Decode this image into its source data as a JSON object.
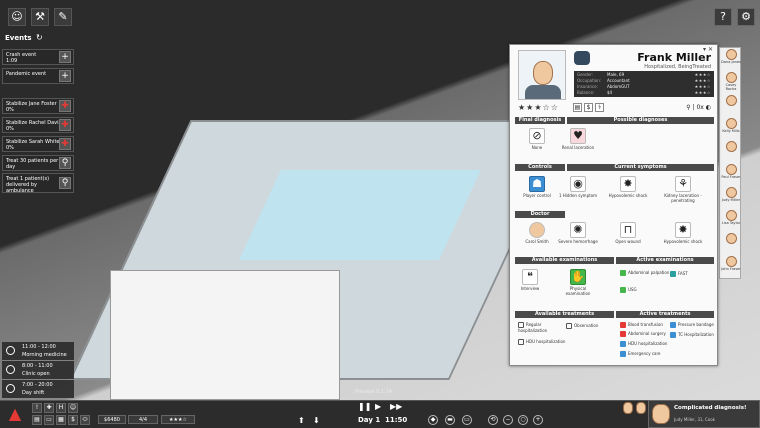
{
  "toolbar": {
    "icons": [
      "staff-icon",
      "hammer-icon",
      "syringe-icon"
    ]
  },
  "events": {
    "title": "Events",
    "items": [
      {
        "label": "Crash event",
        "sub": "1:09",
        "action": "+"
      },
      {
        "label": "Pandemic event",
        "sub": "",
        "action": "+"
      }
    ],
    "tasks": [
      {
        "label": "Stabilize Jane Foster",
        "sub": "0%"
      },
      {
        "label": "Stabilize Rachel Davis",
        "sub": "0%"
      },
      {
        "label": "Stabilize Sarah White",
        "sub": "0%"
      },
      {
        "label": "Treat 30 patients per",
        "sub": "day"
      },
      {
        "label": "Treat 1 patient(s)",
        "sub": "delivered by",
        "sub2": "ambulance"
      }
    ]
  },
  "schedule": [
    {
      "time": "11:00 - 12:00",
      "label": "Morning medicine"
    },
    {
      "time": "8:00 - 11:00",
      "label": "Clinic open"
    },
    {
      "time": "7:00 - 20:00",
      "label": "Day shift"
    }
  ],
  "top_right": {
    "help": "?",
    "settings": "gear-icon"
  },
  "staff": [
    {
      "name": "Dana Jones"
    },
    {
      "name": "Casey Rocha"
    },
    {
      "name": ""
    },
    {
      "name": "Kelly Mills"
    },
    {
      "name": ""
    },
    {
      "name": "Paul Fraser"
    },
    {
      "name": "Judy Miller"
    },
    {
      "name": "Lisa Taylor"
    },
    {
      "name": ""
    },
    {
      "name": "John Fraser"
    }
  ],
  "patient": {
    "name": "Frank Miller",
    "status": "Hospitalized, BeingTreated",
    "info": [
      {
        "k": "Gender:",
        "v": "Male, 69",
        "r": "★★★☆"
      },
      {
        "k": "Occupation:",
        "v": "Accountant",
        "r": "★★★☆"
      },
      {
        "k": "Insurance:",
        "v": "AbdomGUT",
        "r": "★★★☆"
      },
      {
        "k": "Balance:",
        "v": "$4",
        "r": "★★★☆"
      }
    ],
    "stars": "★★★☆☆",
    "counter": "0x",
    "sections": {
      "final_diagnosis": "Final diagnosis",
      "possible_diagnoses": "Possible diagnoses",
      "controls": "Controls",
      "current_symptoms": "Current symptoms",
      "doctor": "Doctor",
      "available_examinations": "Available examinations",
      "active_examinations": "Active examinations",
      "available_treatments": "Available treatments",
      "active_treatments": "Active treatments"
    },
    "final_diag": {
      "label": "None"
    },
    "possible_diag": {
      "label": "Renal laceration"
    },
    "controls": {
      "label": "Player control"
    },
    "symptoms": [
      {
        "label": "1 Hidden symptom"
      },
      {
        "label": "Hypovolemic shock"
      },
      {
        "label": "Kidney laceration - penetrating"
      },
      {
        "label": "Severe hemorrhage"
      },
      {
        "label": "Open wound"
      },
      {
        "label": "Hypovolemic shock"
      }
    ],
    "doctor": {
      "label": "Carol Smith"
    },
    "available_exams": [
      {
        "label": "Interview"
      },
      {
        "label": "Physical examination"
      }
    ],
    "active_exams": [
      {
        "label": "Abdominal palpation"
      },
      {
        "label": "FAST"
      },
      {
        "label": "USG"
      }
    ],
    "available_treatments": [
      {
        "label": "Regular hospitalization"
      },
      {
        "label": "Observation"
      },
      {
        "label": "HDU hospitalization"
      }
    ],
    "active_treatments": [
      {
        "label": "Blood transfusion"
      },
      {
        "label": "Pressure bandage"
      },
      {
        "label": "Abdominal surgery"
      },
      {
        "label": "TC Hospitalization"
      },
      {
        "label": "HDU hospitalization"
      },
      {
        "label": "Emergency care"
      }
    ]
  },
  "bottom": {
    "money": "$6480",
    "staff_count": "4/4",
    "rating": "★★★☆",
    "day": "Day 1",
    "time": "11:50",
    "preview": "Preview 0.1.14",
    "notification": {
      "title": "Complicated diagnosis!",
      "sub": "Judy Miller, 31, Cook"
    }
  }
}
